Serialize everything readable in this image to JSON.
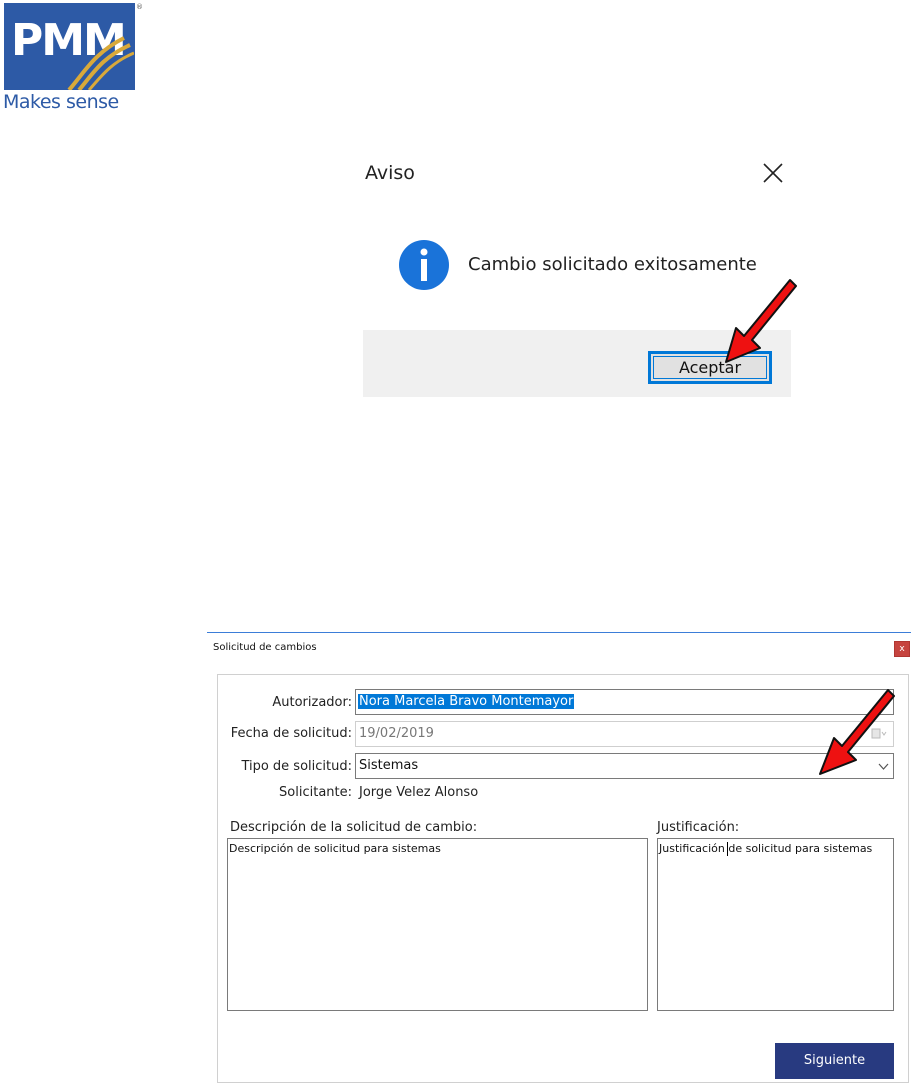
{
  "logo": {
    "brand": "PMM",
    "tagline": "Makes sense",
    "registered": "®"
  },
  "message_dialog": {
    "title": "Aviso",
    "message": "Cambio solicitado exitosamente",
    "ok_label": "Aceptar",
    "icon": "info-icon",
    "accent": "#0078d7"
  },
  "form_window": {
    "title": "Solicitud de cambios",
    "close_label": "x",
    "fields": {
      "autorizador": {
        "label": "Autorizador:",
        "value": "Nora Marcela Bravo Montemayor"
      },
      "fecha": {
        "label": "Fecha de solicitud:",
        "value": "19/02/2019"
      },
      "tipo": {
        "label": "Tipo de solicitud:",
        "value": "Sistemas"
      },
      "solicitante": {
        "label": "Solicitante:",
        "value": "Jorge Velez Alonso"
      }
    },
    "descripcion": {
      "label": "Descripción de la solicitud de cambio:",
      "value": "Descripción de solicitud para sistemas"
    },
    "justificacion": {
      "label": "Justificación:",
      "value": "Justificación de solicitud para sistemas"
    },
    "next_label": "Siguiente",
    "next_color": "#283a80"
  },
  "annotations": {
    "arrow_color": "#ee1111"
  }
}
